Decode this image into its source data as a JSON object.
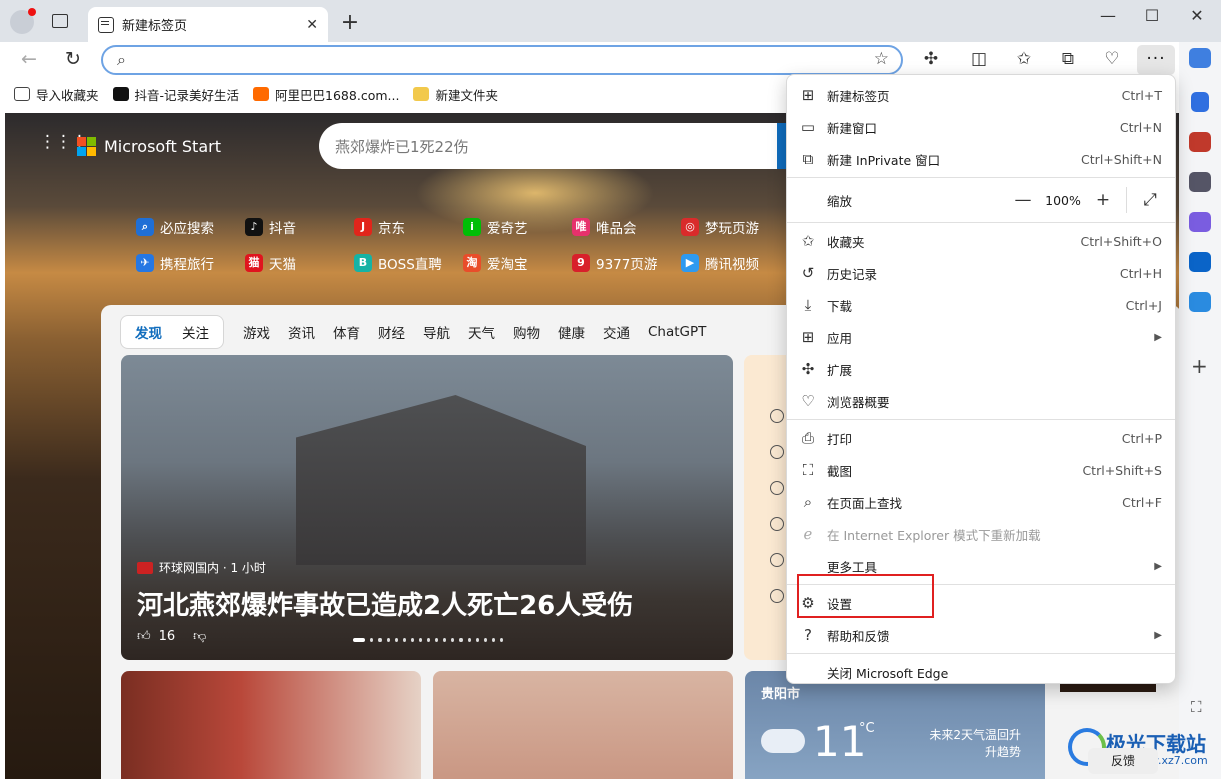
{
  "browser": {
    "tab_title": "新建标签页",
    "address_value": "",
    "bookmarks": [
      {
        "label": "导入收藏夹",
        "icon": "import-icon"
      },
      {
        "label": "抖音-记录美好生活",
        "icon": "douyin-icon"
      },
      {
        "label": "阿里巴巴1688.com...",
        "icon": "alibaba-icon"
      },
      {
        "label": "新建文件夹",
        "icon": "folder-icon"
      }
    ]
  },
  "page": {
    "logo_text": "Microsoft Start",
    "search_placeholder": "燕郊爆炸已1死22伤",
    "quick_links_row1": [
      "必应搜索",
      "抖音",
      "京东",
      "爱奇艺",
      "唯品会",
      "梦玩页游"
    ],
    "quick_links_row2": [
      "携程旅行",
      "天猫",
      "BOSS直聘",
      "爱淘宝",
      "9377页游",
      "腾讯视频"
    ],
    "feed_seg": [
      "发现",
      "关注"
    ],
    "feed_tabs": [
      "游戏",
      "资讯",
      "体育",
      "财经",
      "导航",
      "天气",
      "购物",
      "健康",
      "交通",
      "ChatGPT"
    ],
    "hero": {
      "source": "环球网国内 · 1 小时",
      "title": "河北燕郊爆炸事故已造成2人死亡26人受伤",
      "likes": "16"
    },
    "weather": {
      "city": "贵阳市",
      "temp": "11",
      "unit": "°C",
      "forecast_line1": "未来2天气温回升",
      "forecast_line2": "升趋势"
    },
    "feedback": "反馈"
  },
  "menu": {
    "items": [
      {
        "label": "新建标签页",
        "shortcut": "Ctrl+T",
        "icon": "new-tab-icon"
      },
      {
        "label": "新建窗口",
        "shortcut": "Ctrl+N",
        "icon": "new-window-icon"
      },
      {
        "label": "新建 InPrivate 窗口",
        "shortcut": "Ctrl+Shift+N",
        "icon": "inprivate-icon"
      },
      {
        "label": "缩放",
        "zoom_value": "100%"
      },
      {
        "label": "收藏夹",
        "shortcut": "Ctrl+Shift+O",
        "icon": "favorites-icon"
      },
      {
        "label": "历史记录",
        "shortcut": "Ctrl+H",
        "icon": "history-icon"
      },
      {
        "label": "下载",
        "shortcut": "Ctrl+J",
        "icon": "download-icon"
      },
      {
        "label": "应用",
        "icon": "apps-icon"
      },
      {
        "label": "扩展",
        "icon": "extensions-icon"
      },
      {
        "label": "浏览器概要",
        "icon": "essentials-icon"
      },
      {
        "label": "打印",
        "shortcut": "Ctrl+P",
        "icon": "print-icon"
      },
      {
        "label": "截图",
        "shortcut": "Ctrl+Shift+S",
        "icon": "screenshot-icon"
      },
      {
        "label": "在页面上查找",
        "shortcut": "Ctrl+F",
        "icon": "find-icon"
      },
      {
        "label": "在 Internet Explorer 模式下重新加载",
        "icon": "ie-icon"
      },
      {
        "label": "更多工具"
      },
      {
        "label": "设置",
        "icon": "settings-icon"
      },
      {
        "label": "帮助和反馈",
        "icon": "help-icon"
      },
      {
        "label": "关闭 Microsoft Edge"
      }
    ]
  },
  "watermark": {
    "line1": "极光下载站",
    "line2": "www.xz7.com"
  },
  "colors": {
    "accent": "#0f6cbd",
    "highlight_box": "#e02020"
  }
}
